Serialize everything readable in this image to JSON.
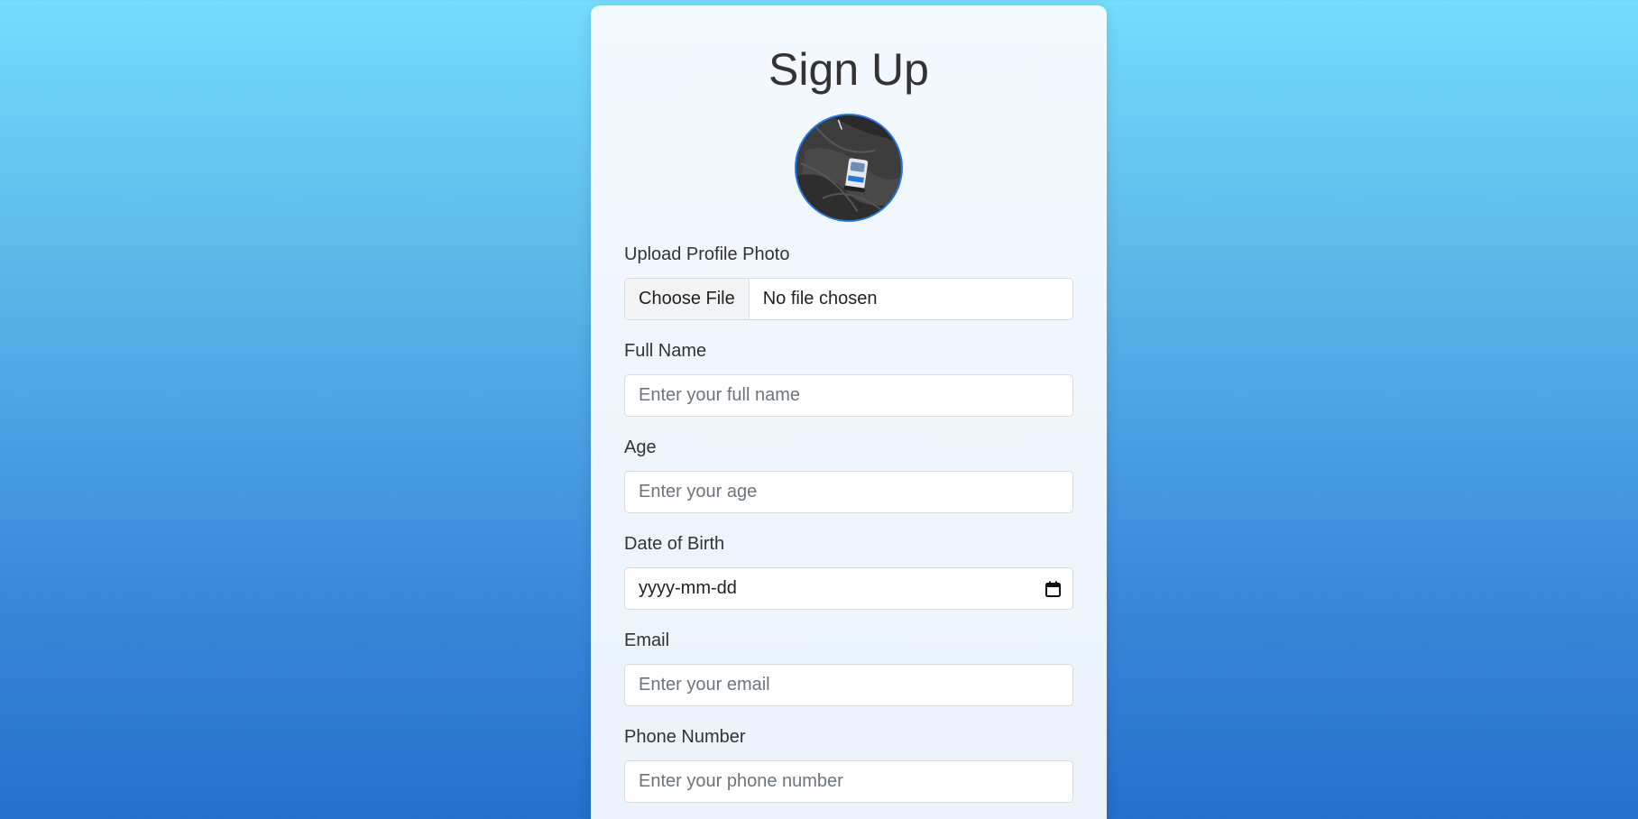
{
  "page": {
    "title": "Sign Up"
  },
  "avatar": {
    "icon": "profile-photo"
  },
  "upload": {
    "label": "Upload Profile Photo",
    "button_label": "Choose File",
    "status": "No file chosen"
  },
  "full_name": {
    "label": "Full Name",
    "placeholder": "Enter your full name"
  },
  "age": {
    "label": "Age",
    "placeholder": "Enter your age"
  },
  "dob": {
    "label": "Date of Birth",
    "format": "yyyy-mm-dd",
    "icon": "calendar-icon"
  },
  "email": {
    "label": "Email",
    "placeholder": "Enter your email"
  },
  "phone": {
    "label": "Phone Number",
    "placeholder": "Enter your phone number"
  },
  "colors": {
    "accent": "#1f78e6",
    "background_top": "#74dcfc",
    "background_bottom": "#246fcb",
    "card": "#f2f9ff"
  }
}
